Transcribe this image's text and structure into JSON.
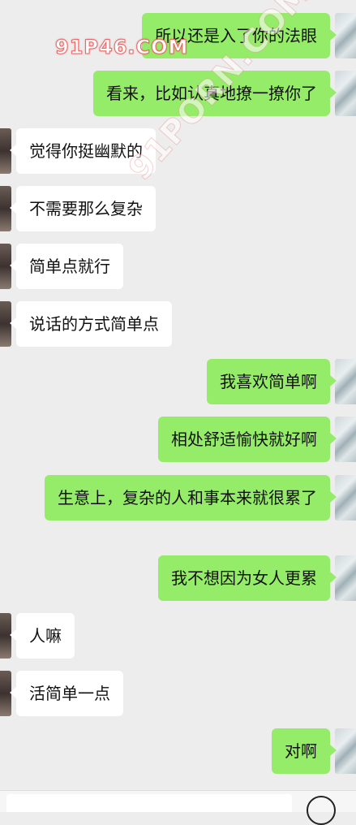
{
  "watermarks": {
    "top": "91P46.COM",
    "diagonal": "91PORN.COM"
  },
  "messages": [
    {
      "side": "right",
      "text": "所以还是入了你的法眼"
    },
    {
      "side": "right",
      "text": "看来，比如认真地撩一撩你了"
    },
    {
      "side": "left",
      "text": "觉得你挺幽默的"
    },
    {
      "side": "left",
      "text": "不需要那么复杂"
    },
    {
      "side": "left",
      "text": "简单点就行"
    },
    {
      "side": "left",
      "text": "说话的方式简单点"
    },
    {
      "side": "right",
      "text": "我喜欢简单啊"
    },
    {
      "side": "right",
      "text": "相处舒适愉快就好啊"
    },
    {
      "side": "right",
      "text": "生意上，复杂的人和事本来就很累了"
    },
    {
      "side": "right",
      "text": "我不想因为女人更累"
    },
    {
      "side": "left",
      "text": "人嘛"
    },
    {
      "side": "left",
      "text": "活简单一点"
    },
    {
      "side": "right",
      "text": "对啊"
    }
  ],
  "input_bar": {
    "value": "",
    "emoji_icon": "emoji-icon"
  }
}
